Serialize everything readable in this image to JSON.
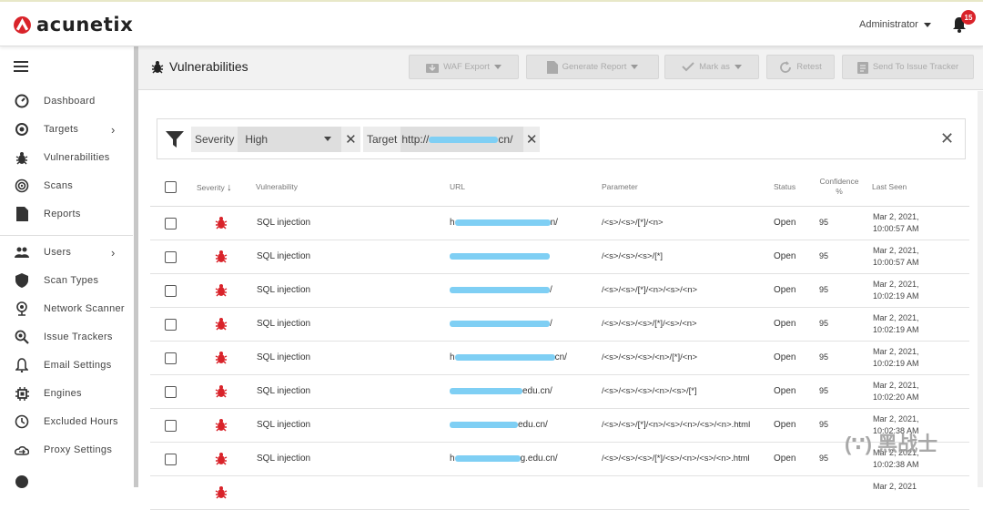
{
  "app": {
    "logo_text": "acunetix"
  },
  "topbar": {
    "user": "Administrator",
    "notifications": "15"
  },
  "sidebar": {
    "items": [
      {
        "label": "Dashboard",
        "icon": "dashboard-icon"
      },
      {
        "label": "Targets",
        "icon": "target-icon",
        "chevron": true
      },
      {
        "label": "Vulnerabilities",
        "icon": "bug-icon"
      },
      {
        "label": "Scans",
        "icon": "radar-icon"
      },
      {
        "label": "Reports",
        "icon": "document-icon"
      },
      {
        "label": "Users",
        "icon": "users-icon",
        "chevron": true
      },
      {
        "label": "Scan Types",
        "icon": "shield-icon"
      },
      {
        "label": "Network Scanner",
        "icon": "network-icon"
      },
      {
        "label": "Issue Trackers",
        "icon": "magnifier-bug-icon"
      },
      {
        "label": "Email Settings",
        "icon": "bell-icon"
      },
      {
        "label": "Engines",
        "icon": "chip-icon"
      },
      {
        "label": "Excluded Hours",
        "icon": "clock-icon"
      },
      {
        "label": "Proxy Settings",
        "icon": "cloud-icon"
      }
    ]
  },
  "header": {
    "title": "Vulnerabilities",
    "buttons": [
      {
        "label": "WAF Export",
        "icon": "export-icon",
        "caret": true
      },
      {
        "label": "Generate Report",
        "icon": "report-icon",
        "caret": true
      },
      {
        "label": "Mark as",
        "icon": "check-icon",
        "caret": true
      },
      {
        "label": "Retest",
        "icon": "refresh-icon",
        "caret": false
      },
      {
        "label": "Send To Issue Tracker",
        "icon": "tracker-icon",
        "caret": false
      }
    ]
  },
  "filter": {
    "severity_key": "Severity",
    "severity_value": "High",
    "target_key": "Target",
    "target_prefix": "http://",
    "target_suffix": "cn/"
  },
  "table": {
    "columns": [
      "Severity",
      "Vulnerability",
      "URL",
      "Parameter",
      "Status",
      "Confidence %",
      "Last Seen"
    ],
    "rows": [
      {
        "vuln": "SQL injection",
        "url_prefix": "h",
        "url_suffix": "n/",
        "param": "/<s>/<s>/[*]/<n>",
        "status": "Open",
        "confidence": "95",
        "date": "Mar 2, 2021,",
        "time": "10:00:57 AM"
      },
      {
        "vuln": "SQL injection",
        "url_prefix": "",
        "url_suffix": "",
        "param": "/<s>/<s>/<s>/[*]",
        "status": "Open",
        "confidence": "95",
        "date": "Mar 2, 2021,",
        "time": "10:00:57 AM"
      },
      {
        "vuln": "SQL injection",
        "url_prefix": "",
        "url_suffix": "/",
        "param": "/<s>/<s>/[*]/<n>/<s>/<n>",
        "status": "Open",
        "confidence": "95",
        "date": "Mar 2, 2021,",
        "time": "10:02:19 AM"
      },
      {
        "vuln": "SQL injection",
        "url_prefix": "",
        "url_suffix": "/",
        "param": "/<s>/<s>/<s>/[*]/<s>/<n>",
        "status": "Open",
        "confidence": "95",
        "date": "Mar 2, 2021,",
        "time": "10:02:19 AM"
      },
      {
        "vuln": "SQL injection",
        "url_prefix": "h",
        "url_suffix": "cn/",
        "param": "/<s>/<s>/<s>/<n>/[*]/<n>",
        "status": "Open",
        "confidence": "95",
        "date": "Mar 2, 2021,",
        "time": "10:02:19 AM"
      },
      {
        "vuln": "SQL injection",
        "url_prefix": "",
        "url_suffix": "edu.cn/",
        "param": "/<s>/<s>/<s>/<n>/<s>/[*]",
        "status": "Open",
        "confidence": "95",
        "date": "Mar 2, 2021,",
        "time": "10:02:20 AM"
      },
      {
        "vuln": "SQL injection",
        "url_prefix": "",
        "url_suffix": "edu.cn/",
        "param": "/<s>/<s>/[*]/<n>/<s>/<n>/<s>/<n>.html",
        "status": "Open",
        "confidence": "95",
        "date": "Mar 2, 2021,",
        "time": "10:02:38 AM"
      },
      {
        "vuln": "SQL injection",
        "url_prefix": "h",
        "url_suffix": "g.edu.cn/",
        "param": "/<s>/<s>/<s>/[*]/<s>/<n>/<s>/<n>.html",
        "status": "Open",
        "confidence": "95",
        "date": "Mar 2, 2021,",
        "time": "10:02:38 AM"
      },
      {
        "vuln": "",
        "url_prefix": "",
        "url_suffix": "",
        "param": "",
        "status": "",
        "confidence": "",
        "date": "Mar 2, 2021",
        "time": ""
      }
    ]
  },
  "overlay": {
    "watermark": "(∵) 黑战士"
  },
  "colors": {
    "accent": "#d9232a",
    "redact": "#7fcff4"
  }
}
